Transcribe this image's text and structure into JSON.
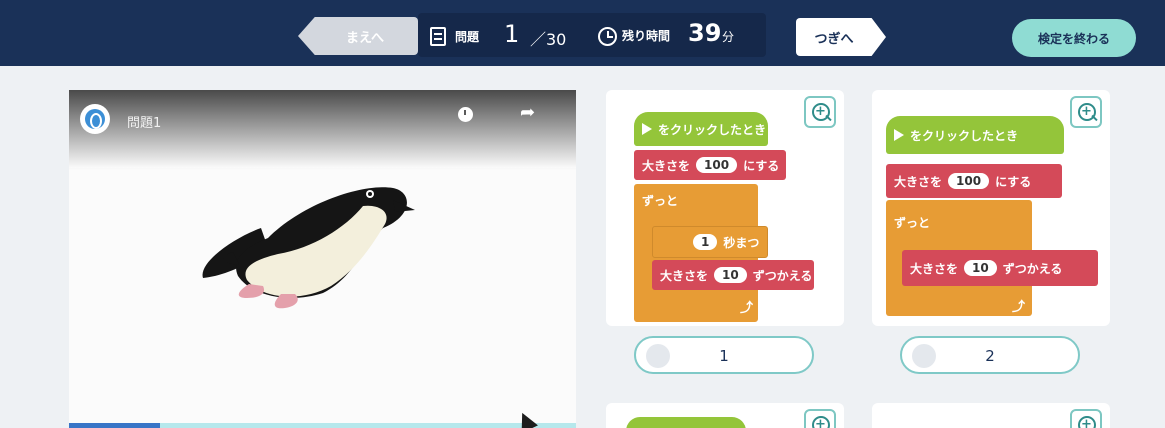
{
  "header": {
    "prev_label": "まえへ",
    "problem_label": "問題",
    "current": "1",
    "slash_total": "／30",
    "remaining_label": "残り時間",
    "remaining_value": "39",
    "remaining_unit": "分",
    "next_label": "つぎへ",
    "finish_label": "検定を終わる"
  },
  "video": {
    "title": "問題1",
    "progress": 0.18
  },
  "choices": [
    {
      "number": "1",
      "blocks": {
        "hat": "をクリックしたとき",
        "size_prefix": "大きさを",
        "size_value": "100",
        "size_suffix": "にする",
        "forever": "ずっと",
        "wait_value": "1",
        "wait_suffix": "秒まつ",
        "change_prefix": "大きさを",
        "change_value": "10",
        "change_suffix": "ずつかえる"
      }
    },
    {
      "number": "2",
      "blocks": {
        "hat": "をクリックしたとき",
        "size_prefix": "大きさを",
        "size_value": "100",
        "size_suffix": "にする",
        "forever": "ずっと",
        "change_prefix": "大きさを",
        "change_value": "10",
        "change_suffix": "ずつかえる"
      }
    }
  ],
  "colors": {
    "header_bg": "#1a3158",
    "finish_button": "#8fdcd3",
    "event_block": "#94c53a",
    "looks_block": "#d44a59",
    "control_block": "#e79c35"
  },
  "icons": [
    "document-icon",
    "clock-icon",
    "zoom-in-icon",
    "share-icon",
    "green-flag-icon",
    "loop-arrow-icon"
  ]
}
